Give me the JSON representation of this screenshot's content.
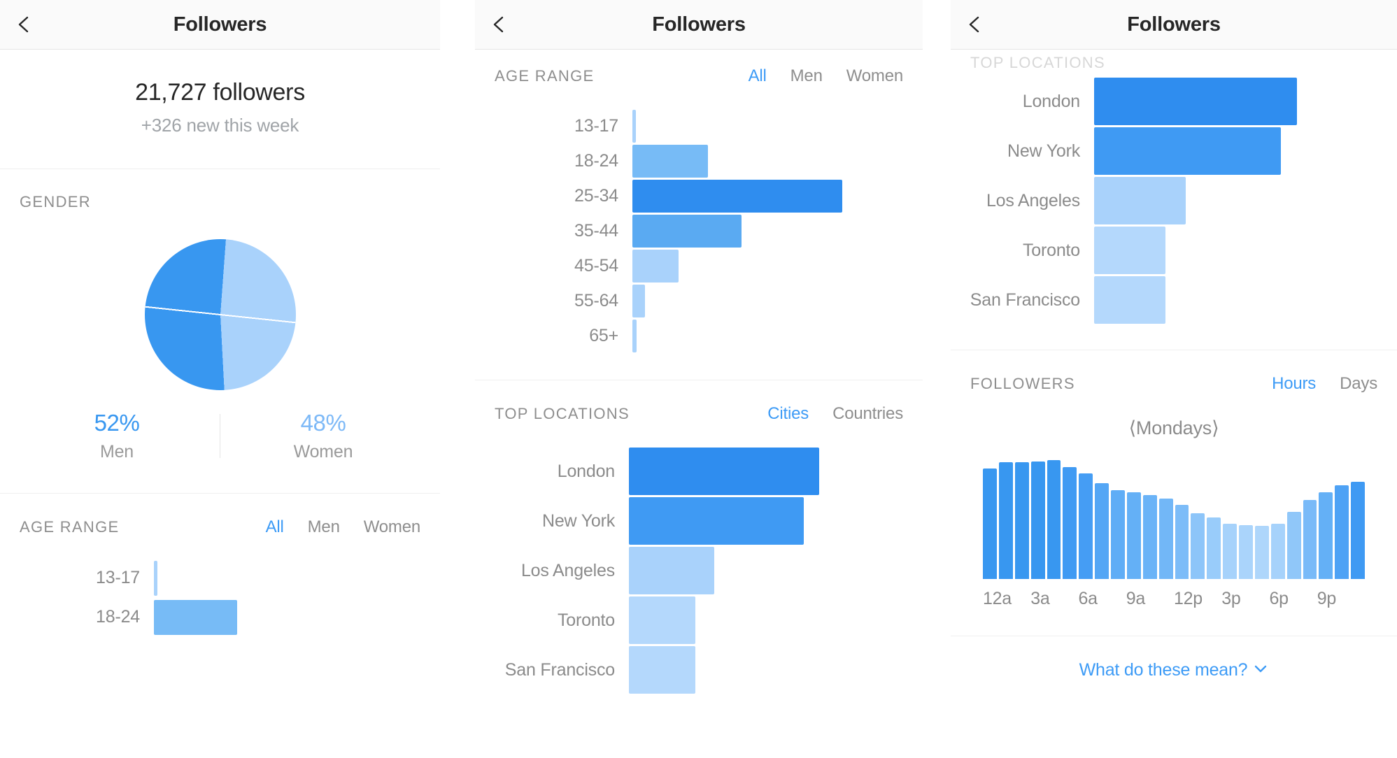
{
  "colors": {
    "accent_dark": "#3897f0",
    "accent_mid": "#5aaaf2",
    "accent_light": "#a9d2fb",
    "text_primary": "#262626",
    "text_muted": "#8e8e8e",
    "link": "#3d9bf6",
    "divider": "#efefef",
    "navbar_bg": "#fafafa"
  },
  "panel1": {
    "nav": {
      "title": "Followers",
      "back_icon": "chevron-left-icon"
    },
    "summary": {
      "total": "21,727 followers",
      "new": "+326 new this week"
    },
    "gender": {
      "section_title": "GENDER",
      "men_pct": "52%",
      "men_label": "Men",
      "women_pct": "48%",
      "women_label": "Women"
    },
    "age_range": {
      "section_title": "AGE RANGE",
      "tabs": [
        {
          "label": "All",
          "active": true
        },
        {
          "label": "Men",
          "active": false
        },
        {
          "label": "Women",
          "active": false
        }
      ],
      "rows": [
        {
          "label": "13-17",
          "pct": 2
        },
        {
          "label": "18-24",
          "pct": 28
        }
      ]
    }
  },
  "panel2": {
    "nav": {
      "title": "Followers",
      "back_icon": "chevron-left-icon"
    },
    "age_range": {
      "section_title": "AGE RANGE",
      "tabs": [
        {
          "label": "All",
          "active": true
        },
        {
          "label": "Men",
          "active": false
        },
        {
          "label": "Women",
          "active": false
        }
      ]
    },
    "top_locations": {
      "section_title": "TOP LOCATIONS",
      "tabs": [
        {
          "label": "Cities",
          "active": true
        },
        {
          "label": "Countries",
          "active": false
        }
      ]
    }
  },
  "panel3": {
    "nav": {
      "title": "Followers",
      "back_icon": "chevron-left-icon"
    },
    "top_locations_cut_title": "TOP LOCATIONS",
    "followers_activity": {
      "section_title": "FOLLOWERS",
      "tabs": [
        {
          "label": "Hours",
          "active": true
        },
        {
          "label": "Days",
          "active": false
        }
      ],
      "weekday_prev_icon": "chevron-left-icon",
      "weekday_next_icon": "chevron-right-icon",
      "weekday": "Mondays"
    },
    "footer_link": {
      "label": "What do these mean?",
      "icon": "chevron-down-icon"
    }
  },
  "chart_data": [
    {
      "id": "gender-pie",
      "type": "pie",
      "title": "GENDER",
      "labels": [
        "Men",
        "Women"
      ],
      "values": [
        52,
        48
      ],
      "unit": "%",
      "colors": [
        "#3897f0",
        "#a9d2fb"
      ],
      "legend": "below"
    },
    {
      "id": "age-range-bars",
      "type": "bar",
      "orientation": "horizontal",
      "title": "AGE RANGE",
      "categories": [
        "13-17",
        "18-24",
        "25-34",
        "35-44",
        "45-54",
        "55-64",
        "65+"
      ],
      "values": [
        1,
        36,
        100,
        52,
        22,
        6,
        2
      ],
      "unit": "relative",
      "xlabel": "",
      "ylabel": "",
      "grid": false,
      "bar_colors": [
        "#a9d2fb",
        "#77bbf6",
        "#2f8def",
        "#5aaaf2",
        "#a9d2fb",
        "#a9d2fb",
        "#a9d2fb"
      ]
    },
    {
      "id": "top-locations-bars",
      "type": "bar",
      "orientation": "horizontal",
      "title": "TOP LOCATIONS",
      "categories": [
        "London",
        "New York",
        "Los Angeles",
        "Toronto",
        "San Francisco"
      ],
      "values": [
        100,
        92,
        45,
        35,
        35
      ],
      "unit": "relative",
      "grid": false,
      "bar_colors": [
        "#2f8def",
        "#3f9af3",
        "#a9d2fb",
        "#b4d8fc",
        "#b4d8fc"
      ]
    },
    {
      "id": "followers-by-hour",
      "type": "bar",
      "orientation": "vertical",
      "title": "FOLLOWERS",
      "subtitle": "Mondays",
      "categories": [
        "12a",
        "1a",
        "2a",
        "3a",
        "4a",
        "5a",
        "6a",
        "7a",
        "8a",
        "9a",
        "10a",
        "11a",
        "12p",
        "1p",
        "2p",
        "3p",
        "4p",
        "5p",
        "6p",
        "7p",
        "8p",
        "9p",
        "10p",
        "11p"
      ],
      "tick_labels": [
        "12a",
        "3a",
        "6a",
        "9a",
        "12p",
        "3p",
        "6p",
        "9p"
      ],
      "values": [
        92,
        97,
        97,
        98,
        99,
        93,
        88,
        80,
        74,
        72,
        70,
        67,
        62,
        55,
        51,
        46,
        45,
        44,
        46,
        56,
        66,
        72,
        78,
        81
      ],
      "grid": false,
      "bar_colors": [
        "#3897f0",
        "#3897f0",
        "#3897f0",
        "#3897f0",
        "#3897f0",
        "#3f9af3",
        "#459df4",
        "#53a6f5",
        "#5fadf6",
        "#64b0f6",
        "#6ab3f7",
        "#72b7f7",
        "#7cbcf8",
        "#8dc5f9",
        "#99ccfa",
        "#a6d2fb",
        "#aad4fb",
        "#aed6fb",
        "#a6d2fb",
        "#90c7f9",
        "#79baf8",
        "#64b0f6",
        "#4ea2f5",
        "#3f9af3"
      ],
      "ylim": [
        0,
        100
      ]
    }
  ]
}
